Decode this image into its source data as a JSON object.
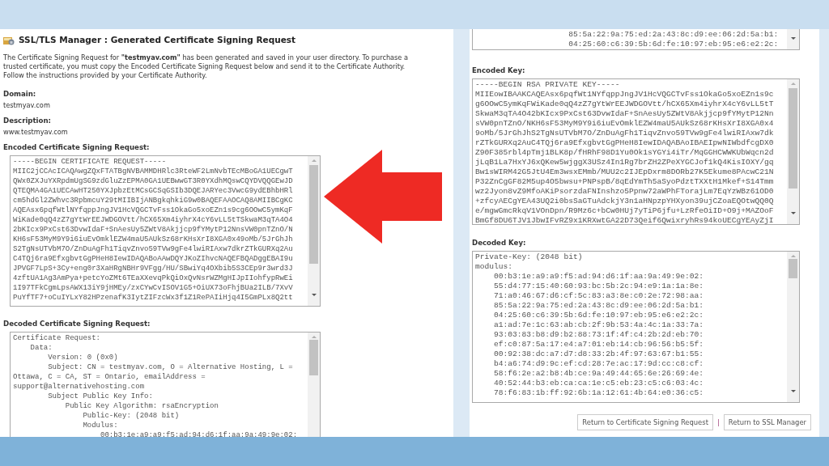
{
  "left_screen": {
    "title": "SSL/TLS Manager : Generated Certificate Signing Request",
    "intro": "The Certificate Signing Request for **\"testmyav.com\"** has been generated and saved in your user directory. To purchase a\ntrusted certificate, you must copy the Encoded Certificate Signing Request below and send it to the Certificate Authority.\nFollow the instructions provided by your Certificate Authority.",
    "fields": [
      {
        "label": "Domain:",
        "value": "testmyav.com"
      },
      {
        "label": "Description:",
        "value": "www.testmyav.com"
      }
    ],
    "encoded_csr": {
      "label": "Encoded Certificate Signing Request:",
      "text": "-----BEGIN CERTIFICATE REQUEST-----\nMIIC2jCCAcICAQAwgZQxFTATBgNVBAMMDHRlc3RteWF2LmNvbTEcMBoGA1UECgwT\nQWx0ZXJuYXRpdmUgSG9zdGluZzEPMA0GA1UEBwwGT3R0YXdhMQswCQYDVQQGEwJD\nQTEQMA4GA1UECAwHT250YXJpbzEtMCsGCSqGSIb3DQEJARYec3VwcG9ydEBhbHRl\ncm5hdGl2ZWhvc3RpbmcuY29tMIIBIjANBgkqhkiG9w0BAQEFAAOCAQ8AMIIBCgKC\nAQEAsx6pqfWtlNYfqppJngJV1HcVQGCTvFss1OkaGo5xoEZn1s9cg6OOwC5ymKqF\nWiKade0qQ4zZ7gYtWrEEJWDGOVtt/hCX65Xm4iyhrX4cY6vLL5tTSkwaM3qTA4O4\n2bKIcx9PxCst63DvwIdaF+SnAesUy5ZWtV8Akjjcp9fYMytP12NnsVW0pnTZnO/N\nKH6sF53MyM9Y9i6iuEvOmklEZW4maU5AUkSz68rKHsXrI8XGA0x49oMb/5JrGhJh\nS2TgNsUTVbM7O/ZnDuAgFh1TiqvZnvo59TVw9gFe4lwiRIAxw7dkrZTkGURXq2Au\nC4TQj6ra9EfxgbvtGgPHeH8IewIDAQABoAAwDQYJKoZIhvcNAQEFBQADggEBAI9u\nJPVGF7LpS+3Cy+eng0r3XaHRgNBHr9VFgg/HU/SBwiYq4OXbib5S3CEp9r3wrd3J\n4zftUA1Ag3AmPya+petcYoZMt6TEaXXevqPkQiOxQvNsrWZMgHIJpIIohfypRwEi\n1I97TFkCgmLpsAWX13iY9jHMEy/zxCYwCvISOV1G5+OiUX73oFhjBUa2ILB/7XvV\nPuYfTF7+oCuIYLxY82HPzenafK3IytZIFzcWx3f1Z1RePAIiHjq4I5GmPLx8Q2tt"
    },
    "decoded_csr": {
      "label": "Decoded Certificate Signing Request:",
      "text": "Certificate Request:\n    Data:\n        Version: 0 (0x0)\n        Subject: CN = testmyav.com, O = Alternative Hosting, L =\nOttawa, C = CA, ST = Ontario, emailAddress =\nsupport@alternativehosting.com\n        Subject Public Key Info:\n            Public Key Algorithm: rsaEncryption\n                Public-Key: (2048 bit)\n                Modulus:\n                    00:b3:1e:a9:a9:f5:ad:94:d6:1f:aa:9a:49:9e:02:"
    }
  },
  "right_screen": {
    "decoded_csr_tail": {
      "text": "                    85:5a:22:9a:75:ed:2a:43:8c:d9:ee:06:2d:5a:b1:\n                    04:25:60:c6:39:5b:6d:fe:10:97:eb:95:e6:e2:2c:"
    },
    "encoded_key": {
      "label": "Encoded Key:",
      "text": "-----BEGIN RSA PRIVATE KEY-----\nMIIEowIBAAKCAQEAsx6pqfWt1NYfqppJngJV1HcVQGCTvFss1OkaGo5xoEZn1s9c\ng6OOwC5ymKqFWiKade0qQ4zZ7gYtWrEEJWDGOVtt/hCX65Xm4iyhrX4cY6vLL5tT\nSkwaM3qTA4O42bKIcx9PxCst63DvwIdaF+SnAesUy5ZWtV8Akjjcp9fYMytP12Nn\nsVW0pnTZnO/NKH6sF53MyM9Y9i6iuEvOmklEZW4maU5AUkSz68rKHsXrI8XGA0x4\n9oMb/5JrGhJhS2TgNsUTVbM7O/ZnDuAgFh1TiqvZnvo59TVw9gFe4lwiRIAxw7dk\nrZTkGURXq2AuC4TQj6ra9EfxgbvtGgPHeH8IewIDAQABAoIBAEIpwNIWbdfcgDX0\nZ90F385rbl4pTmj1BLK8p/fHRhF98D1Yu0Ok1sYGYi4iTr/MqGGHCWWKUbWqcn2d\njLqB1La7HxYJ6xQKew5wjggX3USz4In1Rg7brZH2ZPeXYGCJof1kQ4KisIOXY/gq\nBw1sWIRM42G5JtU4Em3wsxEMmb/MUU2c2IJEpDxrm8DORb27K5Ekume8PAcwC21N\nP32ZnCgGF82M5up4O5bwsu+PNPspB/8qEdYmTh5aSyoPdztTXXtH1Mkef+S14Tmm\nwz2Jyon8vZ9MfoAKiPsorzdaFNInshzo5Ppnw72aWPhFTorajLm7EqYzWBz61OD0\n+zfcyAECgYEA43UQ2i0bsSaGTuAdckjY3n1aHNpzpYHXyon39ujCZoaEQOtwQQ0Q\ne/mgwGmcRkqV1VOnDpn/R9Mz6c+bCw0HUj7yTiP6jfu+LzRfeOiID+O9j+MAZOoF\nBmGf8DU6TJV1JbwIFvRZ9x1KRXwtGA22D73Qeif6QwixryhRs94koUECgYEAyZjI"
    },
    "decoded_key": {
      "label": "Decoded Key:",
      "text": "Private-Key: (2048 bit)\nmodulus:\n    00:b3:1e:a9:a9:f5:ad:94:d6:1f:aa:9a:49:9e:02:\n    55:d4:77:15:40:60:93:bc:5b:2c:94:e9:1a:1a:8e:\n    71:a0:46:67:d6:cf:5c:83:a3:8e:c0:2e:72:98:aa:\n    85:5a:22:9a:75:ed:2a:43:8c:d9:ee:06:2d:5a:b1:\n    04:25:60:c6:39:5b:6d:fe:10:97:eb:95:e6:e2:2c:\n    a1:ad:7e:1c:63:ab:cb:2f:9b:53:4a:4c:1a:33:7a:\n    93:03:83:b8:d9:b2:88:73:1f:4f:c4:2b:2d:eb:70:\n    ef:c0:87:5a:17:e4:a7:01:eb:14:cb:96:56:b5:5f:\n    00:92:38:dc:a7:d7:d8:33:2b:4f:97:63:67:b1:55:\n    b4:a6:74:d9:9c:ef:cd:28:7e:ac:17:9d:cc:c8:cf:\n    58:f6:2e:a2:b8:4b:ce:9a:49:44:65:6e:26:69:4e:\n    40:52:44:b3:eb:ca:ca:1e:c5:eb:23:c5:c6:03:4c:\n    78:f6:83:1b:ff:92:6b:1a:12:61:4b:64:e0:36:c5:"
    },
    "buttons": [
      "Return to Certificate Signing Request",
      "Return to SSL Manager"
    ],
    "button_separator": "|"
  }
}
